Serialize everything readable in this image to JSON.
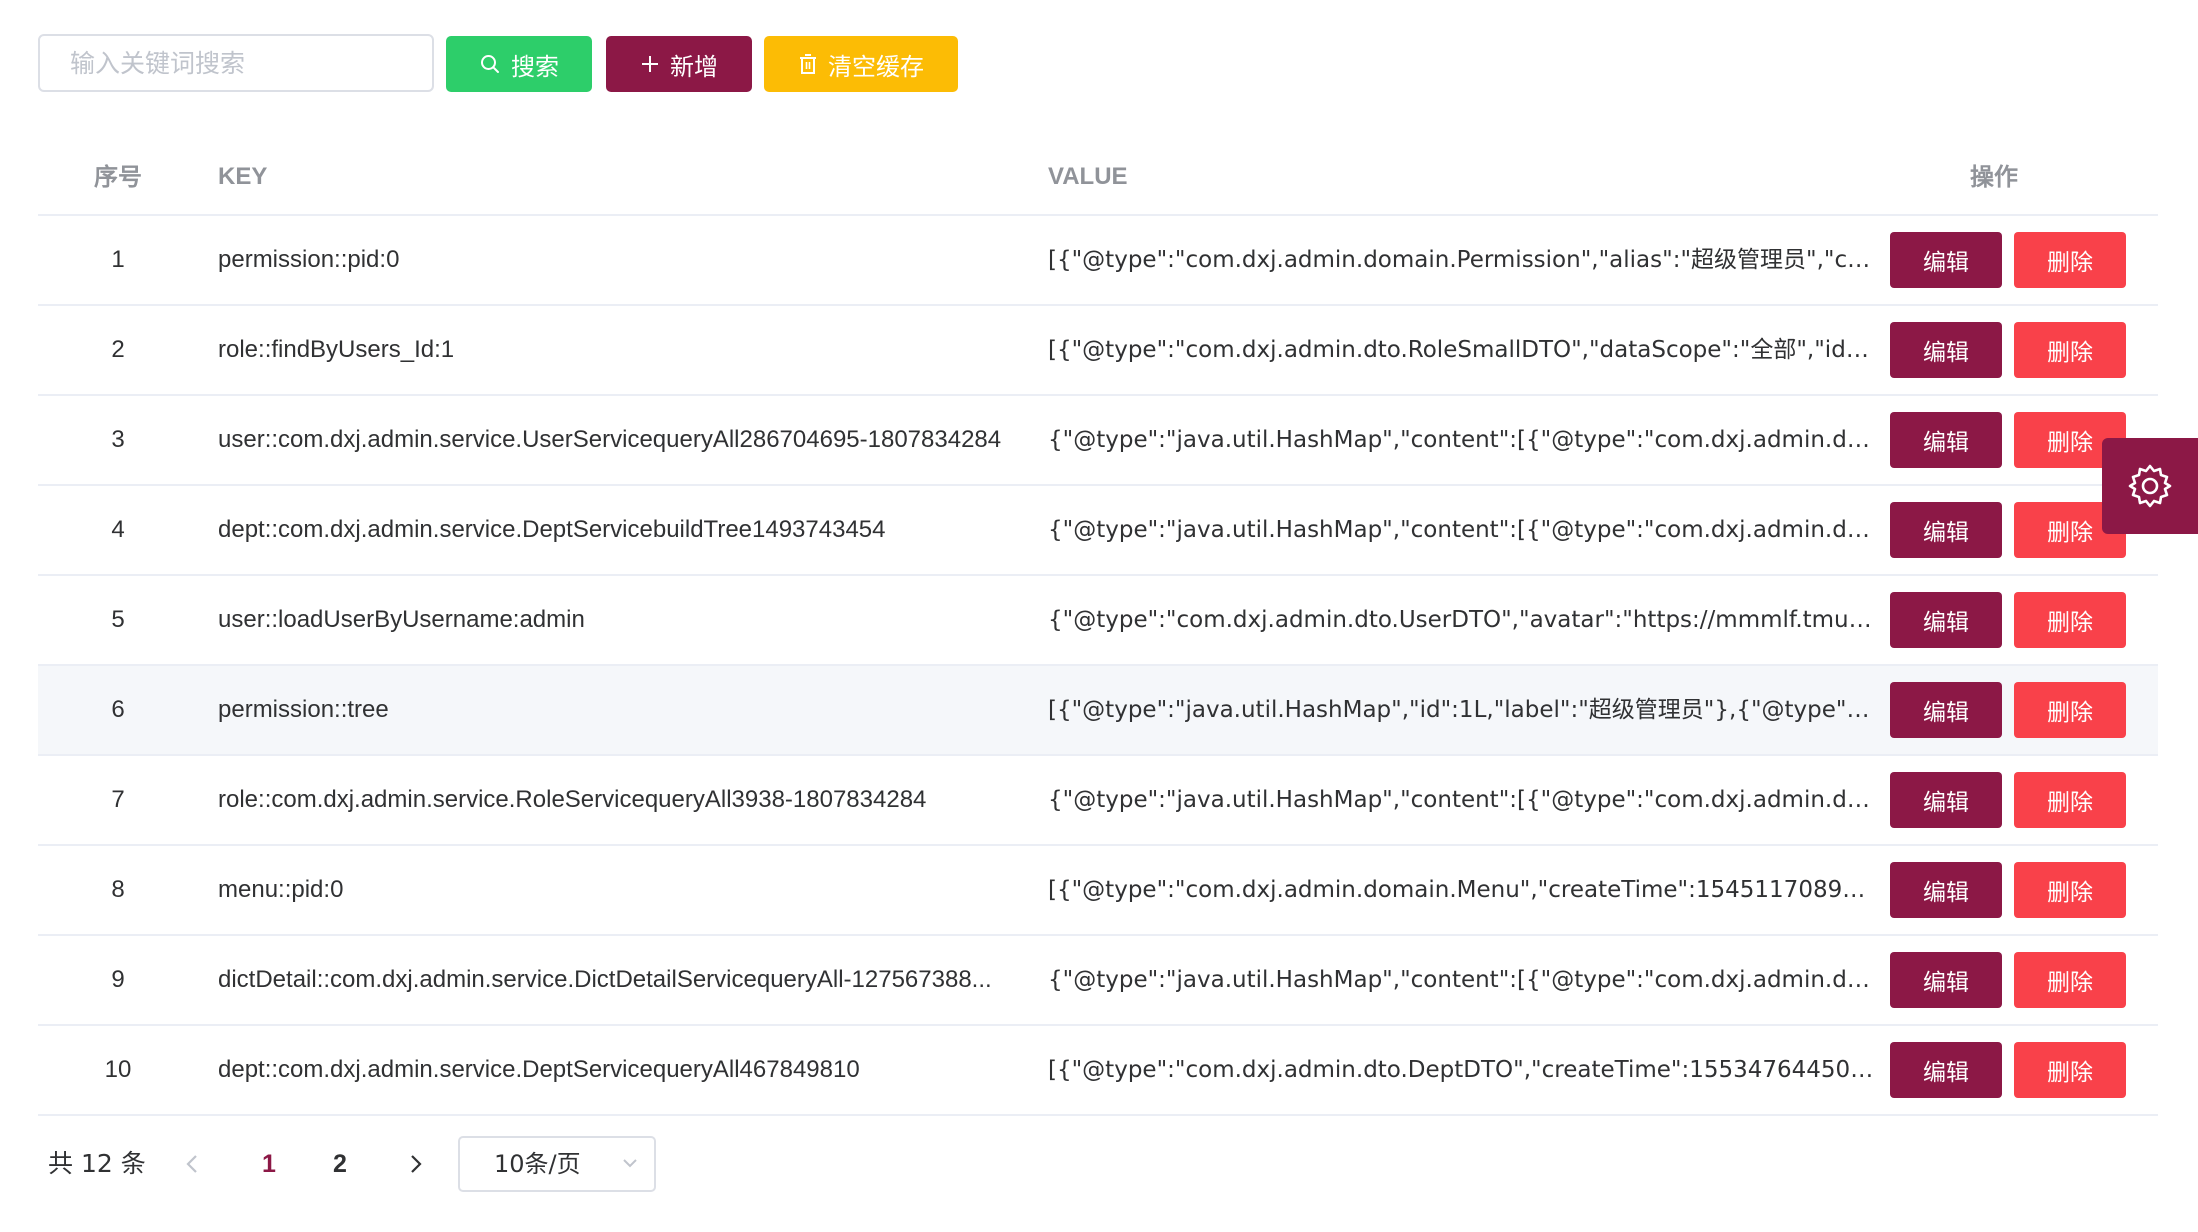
{
  "toolbar": {
    "search_placeholder": "输入关键词搜索",
    "search_value": "",
    "search_label": "搜索",
    "add_label": "新增",
    "clear_label": "清空缓存"
  },
  "table": {
    "headers": {
      "index": "序号",
      "key": "KEY",
      "value": "VALUE",
      "actions": "操作"
    },
    "edit_label": "编辑",
    "delete_label": "删除",
    "rows": [
      {
        "index": "1",
        "key": "permission::pid:0",
        "value": "[{\"@type\":\"com.dxj.admin.domain.Permission\",\"alias\":\"超级管理员\",\"cr..."
      },
      {
        "index": "2",
        "key": "role::findByUsers_Id:1",
        "value": "[{\"@type\":\"com.dxj.admin.dto.RoleSmallDTO\",\"dataScope\":\"全部\",\"id\":..."
      },
      {
        "index": "3",
        "key": "user::com.dxj.admin.service.UserServicequeryAll286704695-1807834284",
        "value": "{\"@type\":\"java.util.HashMap\",\"content\":[{\"@type\":\"com.dxj.admin.dto...."
      },
      {
        "index": "4",
        "key": "dept::com.dxj.admin.service.DeptServicebuildTree1493743454",
        "value": "{\"@type\":\"java.util.HashMap\",\"content\":[{\"@type\":\"com.dxj.admin.dto...."
      },
      {
        "index": "5",
        "key": "user::loadUserByUsername:admin",
        "value": "{\"@type\":\"com.dxj.admin.dto.UserDTO\",\"avatar\":\"https://mmmlf.tmuyu..."
      },
      {
        "index": "6",
        "key": "permission::tree",
        "value": "[{\"@type\":\"java.util.HashMap\",\"id\":1L,\"label\":\"超级管理员\"},{\"@type\":\"j..."
      },
      {
        "index": "7",
        "key": "role::com.dxj.admin.service.RoleServicequeryAll3938-1807834284",
        "value": "{\"@type\":\"java.util.HashMap\",\"content\":[{\"@type\":\"com.dxj.admin.dto...."
      },
      {
        "index": "8",
        "key": "menu::pid:0",
        "value": "[{\"@type\":\"com.dxj.admin.domain.Menu\",\"createTime\":154511708900..."
      },
      {
        "index": "9",
        "key": "dictDetail::com.dxj.admin.service.DictDetailServicequeryAll-127567388...",
        "value": "{\"@type\":\"java.util.HashMap\",\"content\":[{\"@type\":\"com.dxj.admin.dto...."
      },
      {
        "index": "10",
        "key": "dept::com.dxj.admin.service.DeptServicequeryAll467849810",
        "value": "[{\"@type\":\"com.dxj.admin.dto.DeptDTO\",\"createTime\":1553476445000..."
      }
    ]
  },
  "pagination": {
    "total_text": "共 12 条",
    "pages": [
      "1",
      "2"
    ],
    "current_page": "1",
    "page_size": "10条/页"
  },
  "colors": {
    "primary": "#8c1846",
    "success": "#2dce6a",
    "warning": "#fcbc05",
    "danger": "#f9414a"
  },
  "icons": {
    "search_button": "search-icon",
    "add_button": "plus-icon",
    "clear_button": "trash-icon",
    "settings": "gear-icon",
    "prev": "chevron-left-icon",
    "next": "chevron-right-icon",
    "select": "chevron-down-icon"
  }
}
